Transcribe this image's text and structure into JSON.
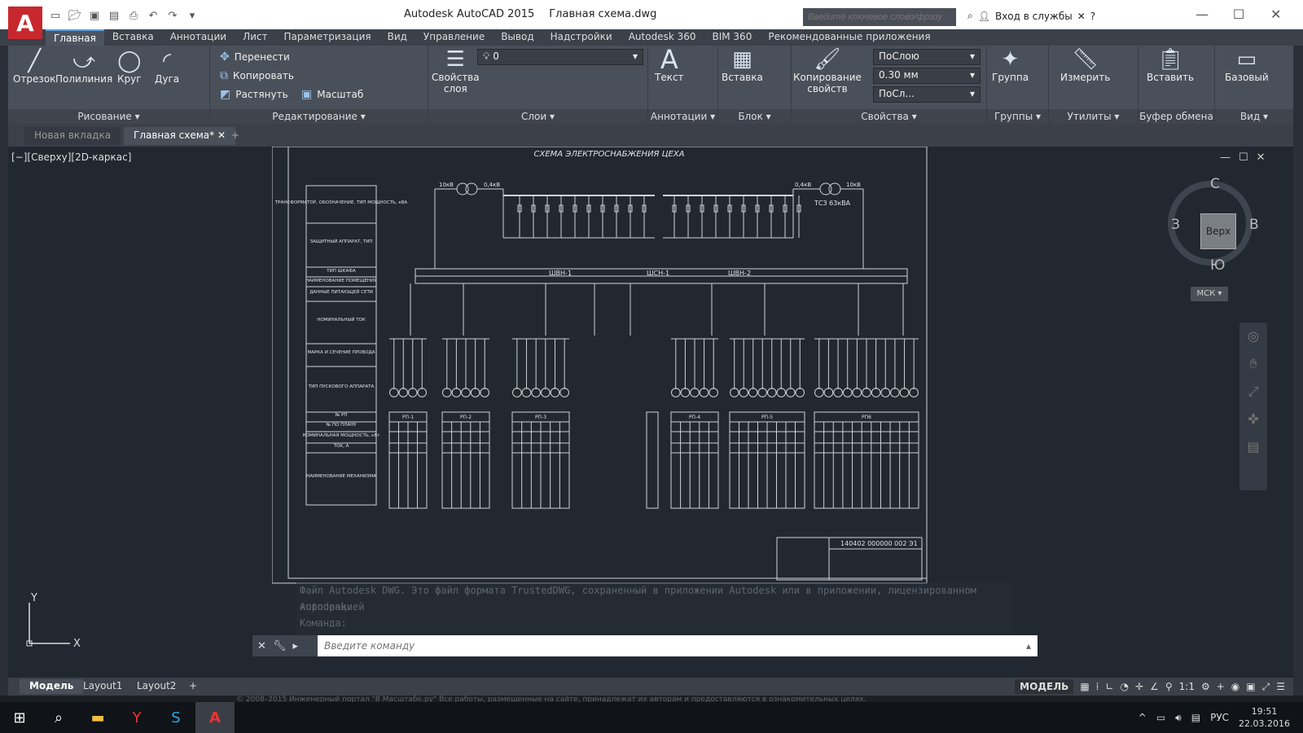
{
  "app": {
    "logo": "A",
    "title": "Autodesk AutoCAD 2015",
    "file": "Главная схема.dwg",
    "search_placeholder": "Введите ключевое слово/фразу",
    "signin": "Вход в службы"
  },
  "menu": [
    "Главная",
    "Вставка",
    "Аннотации",
    "Лист",
    "Параметризация",
    "Вид",
    "Управление",
    "Вывод",
    "Надстройки",
    "Autodesk 360",
    "BIM 360",
    "Рекомендованные приложения"
  ],
  "ribbon": {
    "draw": {
      "title": "Рисование",
      "line": "Отрезок",
      "polyline": "Полилиния",
      "circle": "Круг",
      "arc": "Дуга"
    },
    "modify": {
      "title": "Редактирование",
      "move": "Перенести",
      "copy": "Копировать",
      "stretch": "Растянуть",
      "scale": "Масштаб"
    },
    "layers": {
      "title": "Слои",
      "props": "Свойства\nслоя",
      "current": "0"
    },
    "annot": {
      "title": "Аннотации",
      "text": "Текст"
    },
    "block": {
      "title": "Блок",
      "insert": "Вставка"
    },
    "props": {
      "title": "Свойства",
      "match": "Копирование\nсвойств",
      "color": "ПоСлою",
      "lineweight": "0.30 мм",
      "linetype": "ПоСл..."
    },
    "groups": {
      "title": "Группы",
      "group": "Группа"
    },
    "utils": {
      "title": "Утилиты",
      "measure": "Измерить"
    },
    "clip": {
      "title": "Буфер обмена",
      "paste": "Вставить"
    },
    "view": {
      "title": "Вид",
      "base": "Базовый"
    }
  },
  "tabs": {
    "new": "Новая вкладка",
    "main": "Главная схема*"
  },
  "viewport": {
    "label": "[−][Сверху][2D-каркас]",
    "cube_top": "Верх",
    "n": "С",
    "s": "Ю",
    "w": "З",
    "e": "В",
    "wcs": "МСК"
  },
  "drawing": {
    "title": "СХЕМА ЭЛЕКТРОСНАБЖЕНИЯ ЦЕХА",
    "left_labels": [
      "ТРАНСФОРМАТОР, ОБОЗНАЧЕНИЕ, ТИП МОЩНОСТЬ, кВА",
      "ЗАЩИТНЫЙ АППАРАТ, ТИП",
      "ТИП ШКАФА",
      "НАИМЕНОВАНИЕ ПОМЕЩЕНИЯ",
      "ДАННЫЕ ПИТАЮЩЕЙ СЕТИ",
      "НОМИНАЛЬНЫЙ ТОК",
      "МАРКА И СЕЧЕНИЕ ПРОВОДА",
      "ТИП ПУСКОВОГО АППАРАТА",
      "№ РП",
      "№ ПО ПЛАНУ",
      "НОМИНАЛЬНАЯ МОЩНОСТЬ, кВт",
      "ТОК, А",
      "НАИМЕНОВАНИЕ МЕХАНИЗМА"
    ],
    "busbars": [
      "ШВН-1",
      "ШСН-1",
      "ШВН-2"
    ],
    "tr_left": "10кВ",
    "tr_left2": "0,4кВ",
    "tr_right": "0,4кВ",
    "tr_right2": "10кВ",
    "tr_label": "ТСЗ 63кВА",
    "sections": [
      "РП-1",
      "РП-2",
      "РП-3",
      "РП-4",
      "РП-5",
      "РП6"
    ],
    "stamp": "140402 000000 002 Э1"
  },
  "cmd": {
    "hist1": "Файл Autodesk DWG. Это файл формата TrustedDWG, сохраненный в приложении Autodesk или в приложении, лицензированном корпорацией",
    "hist2": "Autodesk.",
    "hist3": "Команда:",
    "hist4": "Команда:",
    "placeholder": "Введите команду"
  },
  "layouts": [
    "Модель",
    "Layout1",
    "Layout2"
  ],
  "status": {
    "mode": "МОДЕЛЬ",
    "scale": "1:1"
  },
  "footer": "© 2008–2015 Инженерный портал \"В Масштабе.ру\"   Все работы, размещенные на сайте, принадлежат их авторам и предоставляются в ознакомительных целях.",
  "tray": {
    "lang": "РУС",
    "time": "19:51",
    "date": "22.03.2016"
  }
}
